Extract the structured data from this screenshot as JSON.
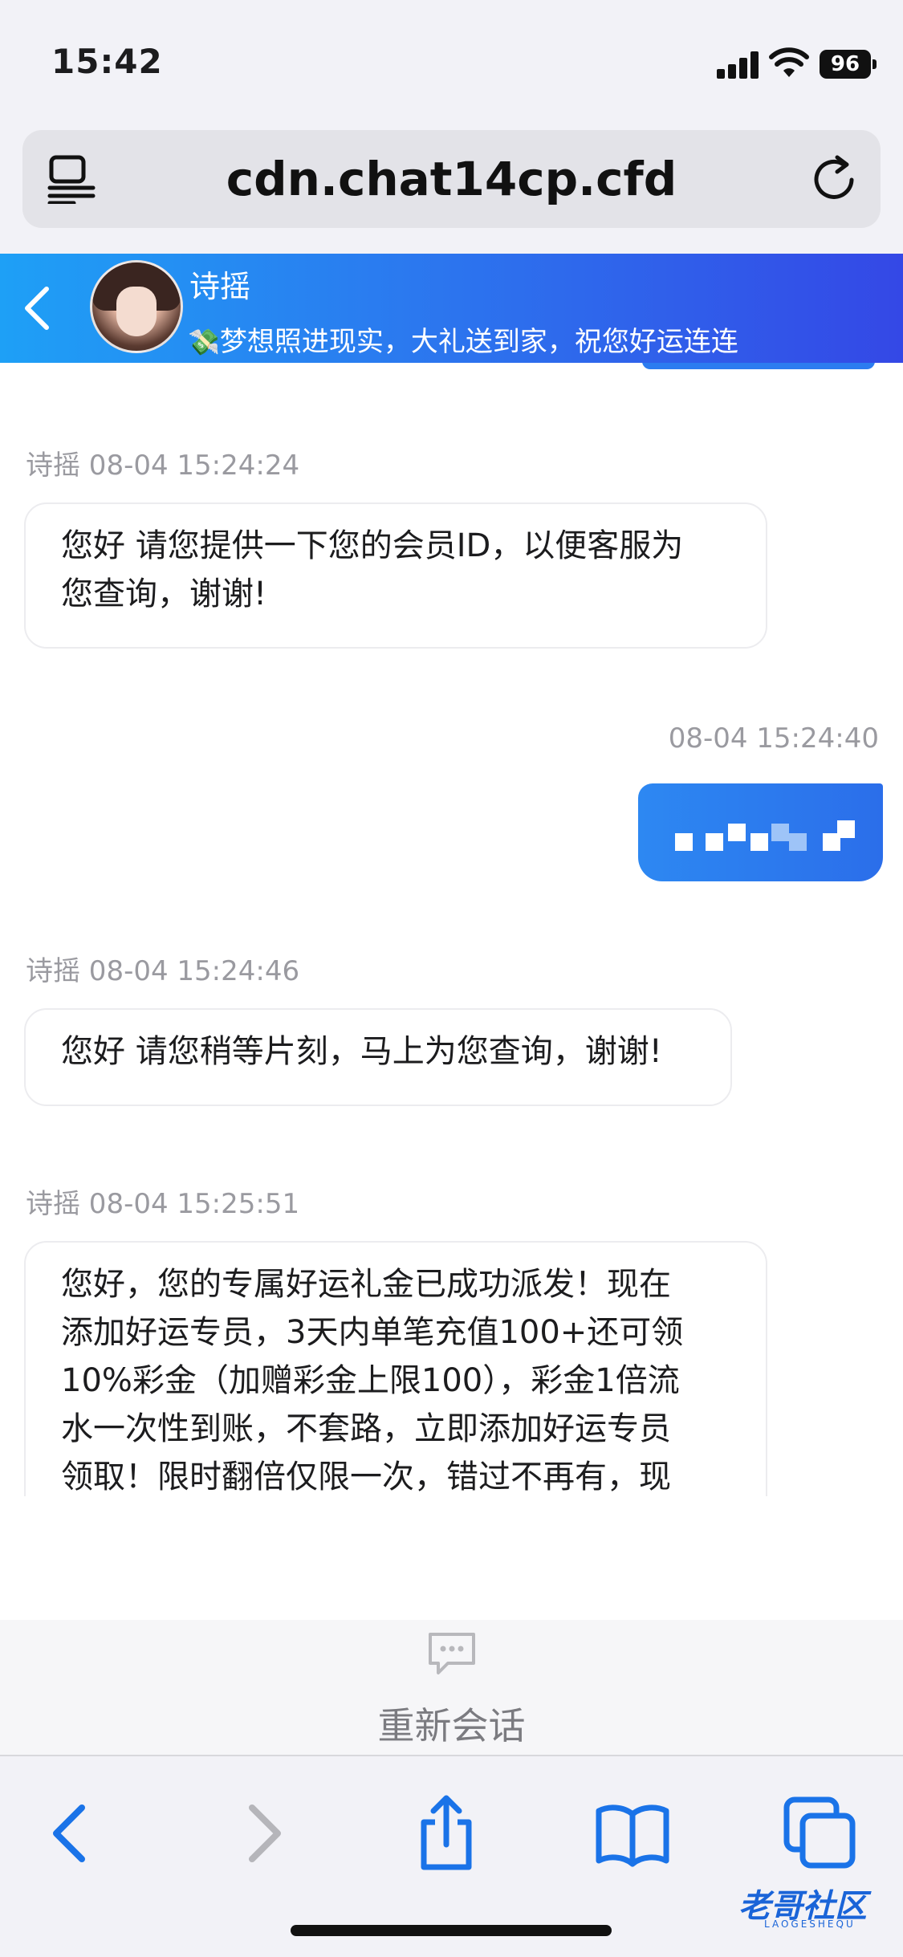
{
  "status_bar": {
    "time": "15:42",
    "battery": "96"
  },
  "browser": {
    "url": "cdn.chat14cp.cfd"
  },
  "chat_header": {
    "agent_name": "诗摇",
    "marquee": "梦想照进现实，大礼送到家，祝您好运连连"
  },
  "messages": [
    {
      "direction": "in",
      "meta": "诗摇 08-04 15:24:24",
      "lines": [
        "您好  请您提供一下您的会员ID，以便客服为",
        "您查询，谢谢!"
      ]
    },
    {
      "direction": "out",
      "meta": "08-04 15:24:40",
      "content": "pixelated"
    },
    {
      "direction": "in",
      "meta": "诗摇 08-04 15:24:46",
      "lines": [
        "您好 请您稍等片刻，马上为您查询，谢谢!"
      ]
    },
    {
      "direction": "in",
      "meta": "诗摇 08-04 15:25:51",
      "lines": [
        "您好，您的专属好运礼金已成功派发！现在",
        "添加好运专员，3天内单笔充值100+还可领",
        "10%彩金（加赠彩金上限100），彩金1倍流",
        "水一次性到账，不套路，立即添加好运专员",
        "领取！限时翻倍仅限一次，错过不再有，现"
      ]
    }
  ],
  "session": {
    "label": "重新会话"
  },
  "watermark": {
    "text": "老哥社区",
    "sub": "LAOGESHEQU"
  },
  "colors": {
    "accent": "#2b79ef",
    "header_start": "#1ea0f6",
    "header_end": "#3448e6",
    "toolbar_icon": "#1a73e8"
  }
}
